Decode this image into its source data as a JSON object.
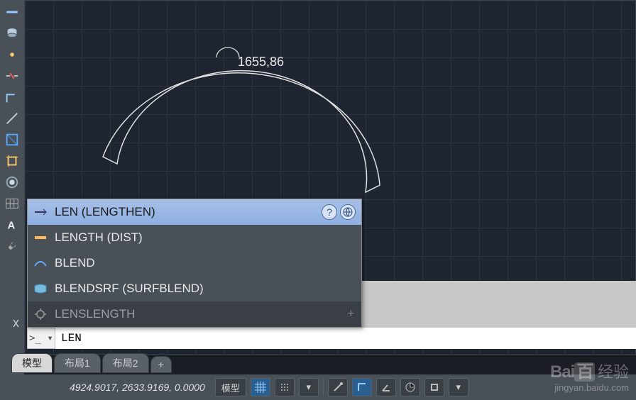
{
  "dimension": {
    "value": "1655,86"
  },
  "autocomplete": {
    "items": [
      {
        "label": "LEN (LENGTHEN)",
        "icon": "lengthen"
      },
      {
        "label": "LENGTH (DIST)",
        "icon": "dist"
      },
      {
        "label": "BLEND",
        "icon": "blend"
      },
      {
        "label": "BLENDSRF (SURFBLEND)",
        "icon": "blendsrf"
      }
    ],
    "category": "LENSLENGTH"
  },
  "command": {
    "prompt": ">_ ▾",
    "value": "LEN"
  },
  "tabs": [
    {
      "label": "模型",
      "active": true
    },
    {
      "label": "布局1",
      "active": false
    },
    {
      "label": "布局2",
      "active": false
    }
  ],
  "tabs_add": "+",
  "status": {
    "coords": "4924.9017, 2633.9169, 0.0000",
    "model_label": "模型"
  },
  "watermark": {
    "brand": "Bai",
    "brand2": "百",
    "cn": "经验",
    "url": "jingyan.baidu.com"
  }
}
